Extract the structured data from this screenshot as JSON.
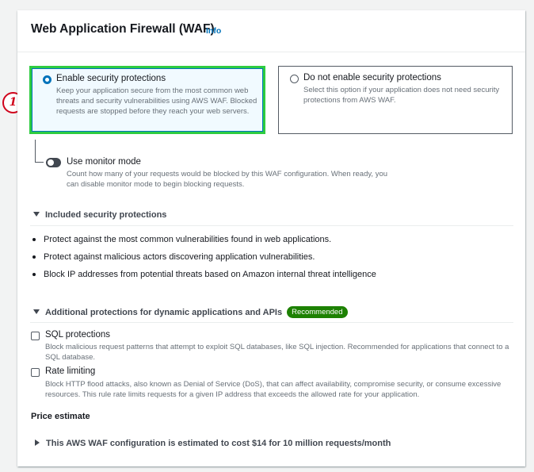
{
  "panel": {
    "title": "Web Application Firewall (WAF)",
    "info_link": "Info"
  },
  "step_badge": "1",
  "options": {
    "enable": {
      "title": "Enable security protections",
      "description": "Keep your application secure from the most common web threats and security vulnerabilities using AWS WAF. Blocked requests are stopped before they reach your web servers.",
      "selected": true
    },
    "disable": {
      "title": "Do not enable security protections",
      "description": "Select this option if your application does not need security protections from AWS WAF.",
      "selected": false
    }
  },
  "monitor_mode": {
    "title": "Use monitor mode",
    "description": "Count how many of your requests would be blocked by this WAF configuration. When ready, you can disable monitor mode to begin blocking requests.",
    "enabled": false
  },
  "included": {
    "heading": "Included security protections",
    "items": [
      "Protect against the most common vulnerabilities found in web applications.",
      "Protect against malicious actors discovering application vulnerabilities.",
      "Block IP addresses from potential threats based on Amazon internal threat intelligence"
    ]
  },
  "additional": {
    "heading": "Additional protections for dynamic applications and APIs",
    "badge": "Recommended",
    "sql": {
      "title": "SQL protections",
      "description": "Block malicious request patterns that attempt to exploit SQL databases, like SQL injection. Recommended for applications that connect to a SQL database.",
      "checked": false
    },
    "rate": {
      "title": "Rate limiting",
      "description": "Block HTTP flood attacks, also known as Denial of Service (DoS), that can affect availability, compromise security, or consume excessive resources. This rule rate limits requests for a given IP address that exceeds the allowed rate for your application.",
      "checked": false
    }
  },
  "price": {
    "heading": "Price estimate",
    "summary": "This AWS WAF configuration is estimated to cost $14 for 10 million requests/month"
  },
  "colors": {
    "accent": "#0073bb",
    "highlight_border": "#2ecc40",
    "recommended_badge": "#1d8102",
    "step_badge": "#d0021b"
  },
  "icons": {
    "selected_radio": "radio-selected-icon",
    "unselected_radio": "radio-unselected-icon",
    "expanded_section": "caret-down-icon",
    "collapsed_section": "caret-right-icon"
  }
}
